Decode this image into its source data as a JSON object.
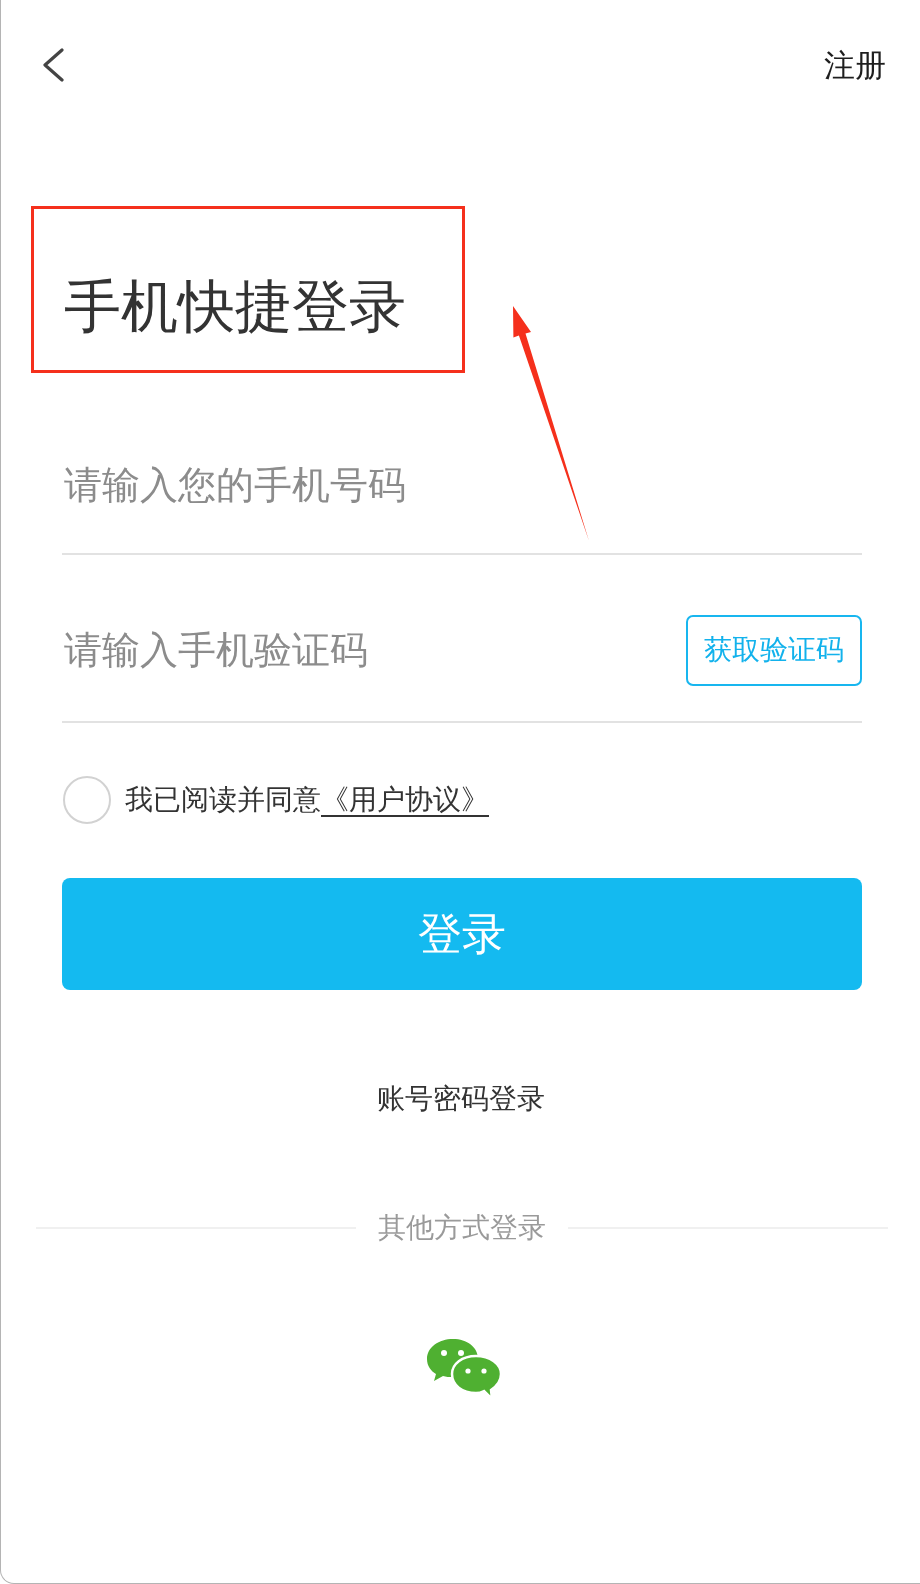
{
  "nav": {
    "register": "注册"
  },
  "title": {
    "text": "手机快捷登录",
    "highlighted": true
  },
  "phone_field": {
    "placeholder": "请输入您的手机号码"
  },
  "code_field": {
    "placeholder": "请输入手机验证码",
    "button": "获取验证码"
  },
  "agreement": {
    "checked": false,
    "text": "我已阅读并同意",
    "link": "《用户协议》"
  },
  "login_button": "登录",
  "alt_login": "账号密码登录",
  "other_login": {
    "label": "其他方式登录",
    "methods": [
      {
        "kind": "chat"
      }
    ]
  }
}
